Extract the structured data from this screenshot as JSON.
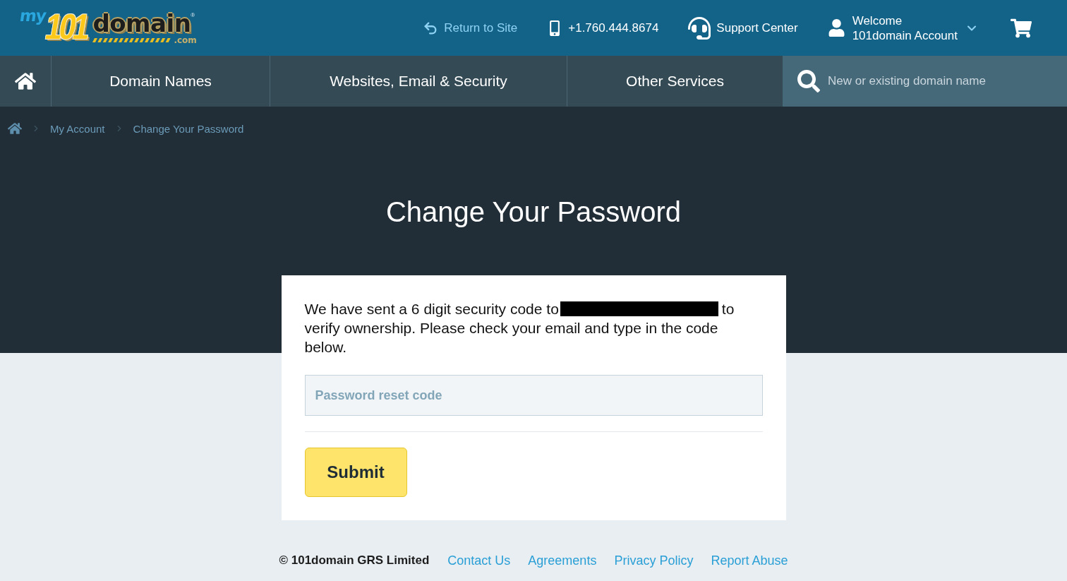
{
  "header": {
    "logo": {
      "prefix": "my",
      "number": "101",
      "wordmark": "domain",
      "registered": "®",
      "suffix": ".com"
    },
    "links": [
      {
        "kind": "return",
        "label": "Return to Site"
      },
      {
        "kind": "phone",
        "label": "+1.760.444.8674"
      },
      {
        "kind": "support",
        "label": "Support Center"
      }
    ],
    "account": {
      "greeting": "Welcome",
      "name": "101domain Account"
    }
  },
  "nav": {
    "items": [
      "Domain Names",
      "Websites, Email & Security",
      "Other Services"
    ],
    "search": {
      "placeholder": "New or existing domain name"
    }
  },
  "breadcrumb": [
    "My Account",
    "Change Your Password"
  ],
  "page_title": "Change Your Password",
  "form": {
    "message": {
      "before": "We have sent a 6 digit security code to",
      "redacted": true,
      "after": "to verify ownership. Please check your email and type in the code below."
    },
    "code_field": {
      "placeholder": "Password reset code"
    },
    "submit": "Submit"
  },
  "footer": {
    "copyright": "© 101domain GRS Limited",
    "links": [
      "Contact Us",
      "Agreements",
      "Privacy Policy",
      "Report Abuse"
    ]
  }
}
